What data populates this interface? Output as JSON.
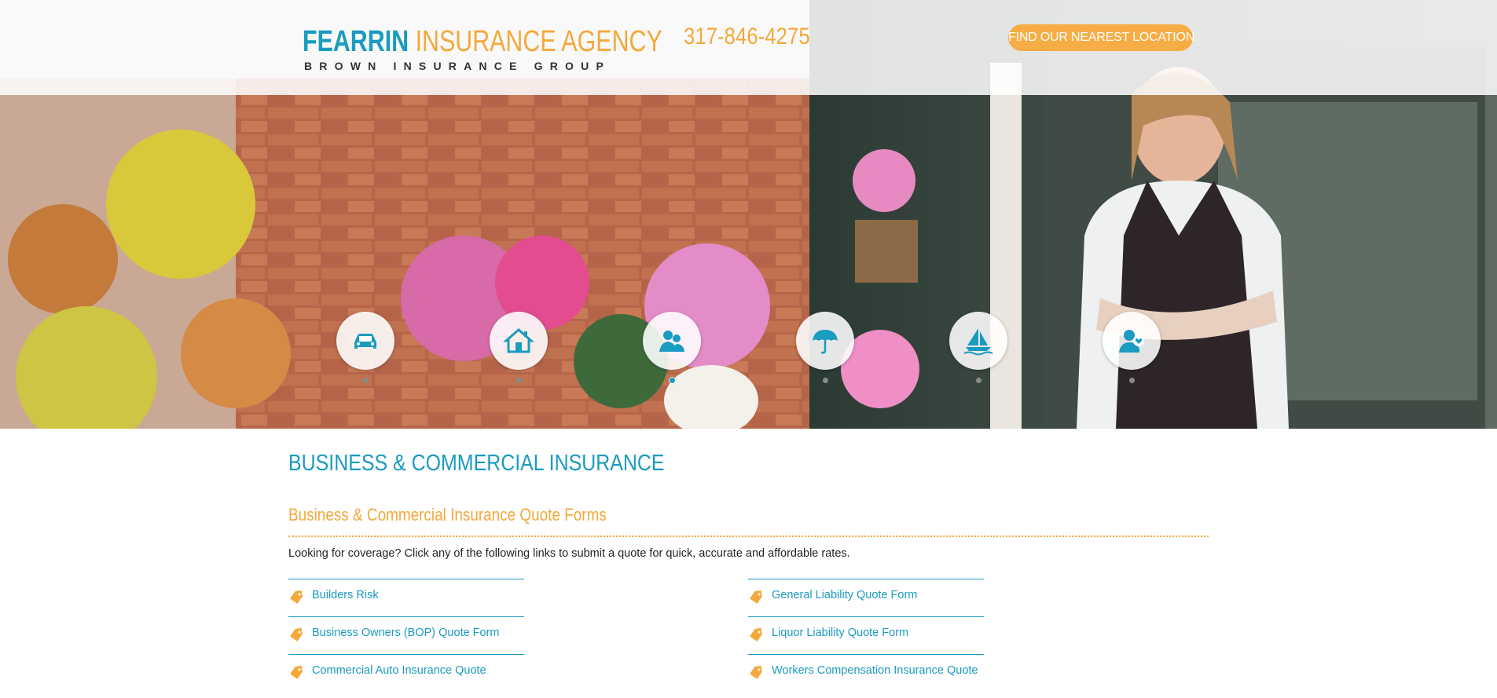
{
  "header": {
    "logo_primary": "FEARRIN",
    "logo_secondary": "INSURANCE AGENCY",
    "logo_tagline": "BROWN INSURANCE GROUP",
    "phone": "317-846-4275",
    "cta_label": "FIND OUR NEAREST LOCATION"
  },
  "carousel": {
    "icons": [
      {
        "name": "car-icon"
      },
      {
        "name": "home-icon"
      },
      {
        "name": "business-people-icon",
        "active": true
      },
      {
        "name": "umbrella-icon"
      },
      {
        "name": "boat-icon"
      },
      {
        "name": "health-person-icon"
      }
    ]
  },
  "main": {
    "title": "BUSINESS & COMMERCIAL INSURANCE",
    "section_title": "Business & Commercial Insurance Quote Forms",
    "intro": "Looking for coverage? Click any of the following links to submit a quote for quick, accurate and affordable rates.",
    "links_left": [
      "Builders Risk",
      "Business Owners (BOP) Quote Form",
      "Commercial Auto Insurance Quote"
    ],
    "links_right": [
      "General Liability Quote Form",
      "Liquor Liability Quote Form",
      "Workers Compensation Insurance Quote"
    ]
  },
  "colors": {
    "brand_blue": "#1a9bc0",
    "brand_orange": "#f4a83a"
  }
}
